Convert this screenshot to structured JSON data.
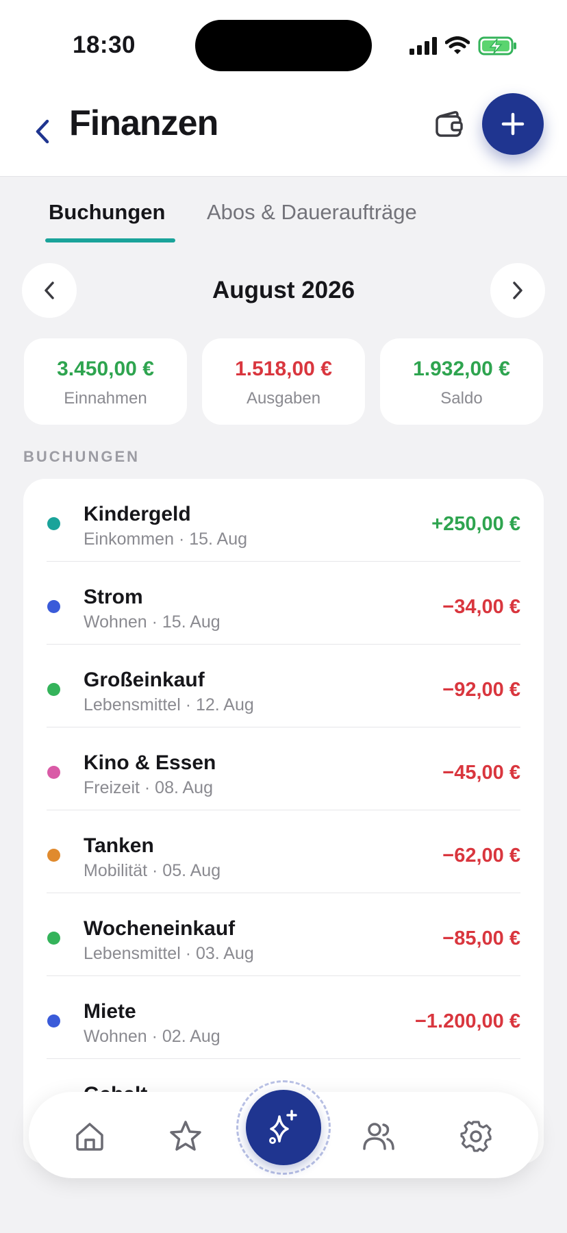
{
  "status_bar": {
    "time": "18:30",
    "icons": [
      "signal-icon",
      "wifi-icon",
      "battery-charging-icon"
    ]
  },
  "header": {
    "title": "Finanzen",
    "icons": [
      "back-chevron-icon",
      "wallet-icon",
      "plus-icon"
    ],
    "accent_color": "#1f3590"
  },
  "tabs": [
    {
      "label": "Buchungen",
      "active": true
    },
    {
      "label": "Abos & Daueraufträge",
      "active": false
    }
  ],
  "month": {
    "label": "August 2026"
  },
  "summary": [
    {
      "amount": "3.450,00 €",
      "label": "Einnahmen",
      "color": "#2ea44f"
    },
    {
      "amount": "1.518,00 €",
      "label": "Ausgaben",
      "color": "#d9363e"
    },
    {
      "amount": "1.932,00 €",
      "label": "Saldo",
      "color": "#2ea44f"
    }
  ],
  "section_title": "BUCHUNGEN",
  "transactions": [
    {
      "name": "Kindergeld",
      "meta": "Einkommen · 15. Aug",
      "amount": "+250,00 €",
      "dot_color": "#1aa39a",
      "amount_color": "#2ea44f"
    },
    {
      "name": "Strom",
      "meta": "Wohnen · 15. Aug",
      "amount": "−34,00 €",
      "dot_color": "#3a5bd9",
      "amount_color": "#d9363e"
    },
    {
      "name": "Großeinkauf",
      "meta": "Lebensmittel · 12. Aug",
      "amount": "−92,00 €",
      "dot_color": "#34b35a",
      "amount_color": "#d9363e"
    },
    {
      "name": "Kino & Essen",
      "meta": "Freizeit · 08. Aug",
      "amount": "−45,00 €",
      "dot_color": "#d95aa6",
      "amount_color": "#d9363e"
    },
    {
      "name": "Tanken",
      "meta": "Mobilität · 05. Aug",
      "amount": "−62,00 €",
      "dot_color": "#e08a2e",
      "amount_color": "#d9363e"
    },
    {
      "name": "Wocheneinkauf",
      "meta": "Lebensmittel · 03. Aug",
      "amount": "−85,00 €",
      "dot_color": "#34b35a",
      "amount_color": "#d9363e"
    },
    {
      "name": "Miete",
      "meta": "Wohnen · 02. Aug",
      "amount": "−1.200,00 €",
      "dot_color": "#3a5bd9",
      "amount_color": "#d9363e"
    },
    {
      "name": "Gehalt",
      "meta": "",
      "amount": "",
      "dot_color": "#1aa39a",
      "amount_color": "#2ea44f"
    }
  ],
  "tab_bar": {
    "items": [
      "home-icon",
      "star-icon",
      "sparkles-icon",
      "users-icon",
      "settings-icon"
    ]
  }
}
